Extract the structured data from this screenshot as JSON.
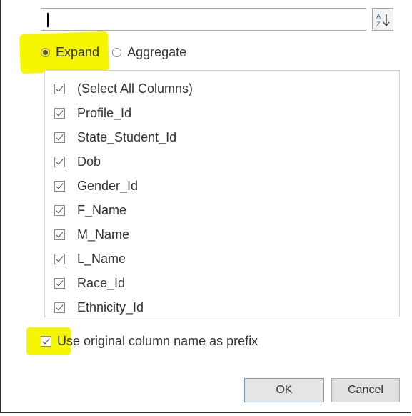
{
  "search": {
    "value": "",
    "placeholder": ""
  },
  "sort_icon": "sort-az-icon",
  "mode": {
    "options": [
      {
        "label": "Expand",
        "selected": true
      },
      {
        "label": "Aggregate",
        "selected": false
      }
    ]
  },
  "columns": {
    "items": [
      {
        "label": "(Select All Columns)",
        "checked": true
      },
      {
        "label": "Profile_Id",
        "checked": true
      },
      {
        "label": "State_Student_Id",
        "checked": true
      },
      {
        "label": "Dob",
        "checked": true
      },
      {
        "label": "Gender_Id",
        "checked": true
      },
      {
        "label": "F_Name",
        "checked": true
      },
      {
        "label": "M_Name",
        "checked": true
      },
      {
        "label": "L_Name",
        "checked": true
      },
      {
        "label": "Race_Id",
        "checked": true
      },
      {
        "label": "Ethnicity_Id",
        "checked": true
      }
    ]
  },
  "prefix": {
    "label": "Use original column name as prefix",
    "checked": true
  },
  "buttons": {
    "ok": "OK",
    "cancel": "Cancel"
  },
  "colors": {
    "highlight": "#f6f600",
    "ok_border": "#7a9cc6"
  }
}
